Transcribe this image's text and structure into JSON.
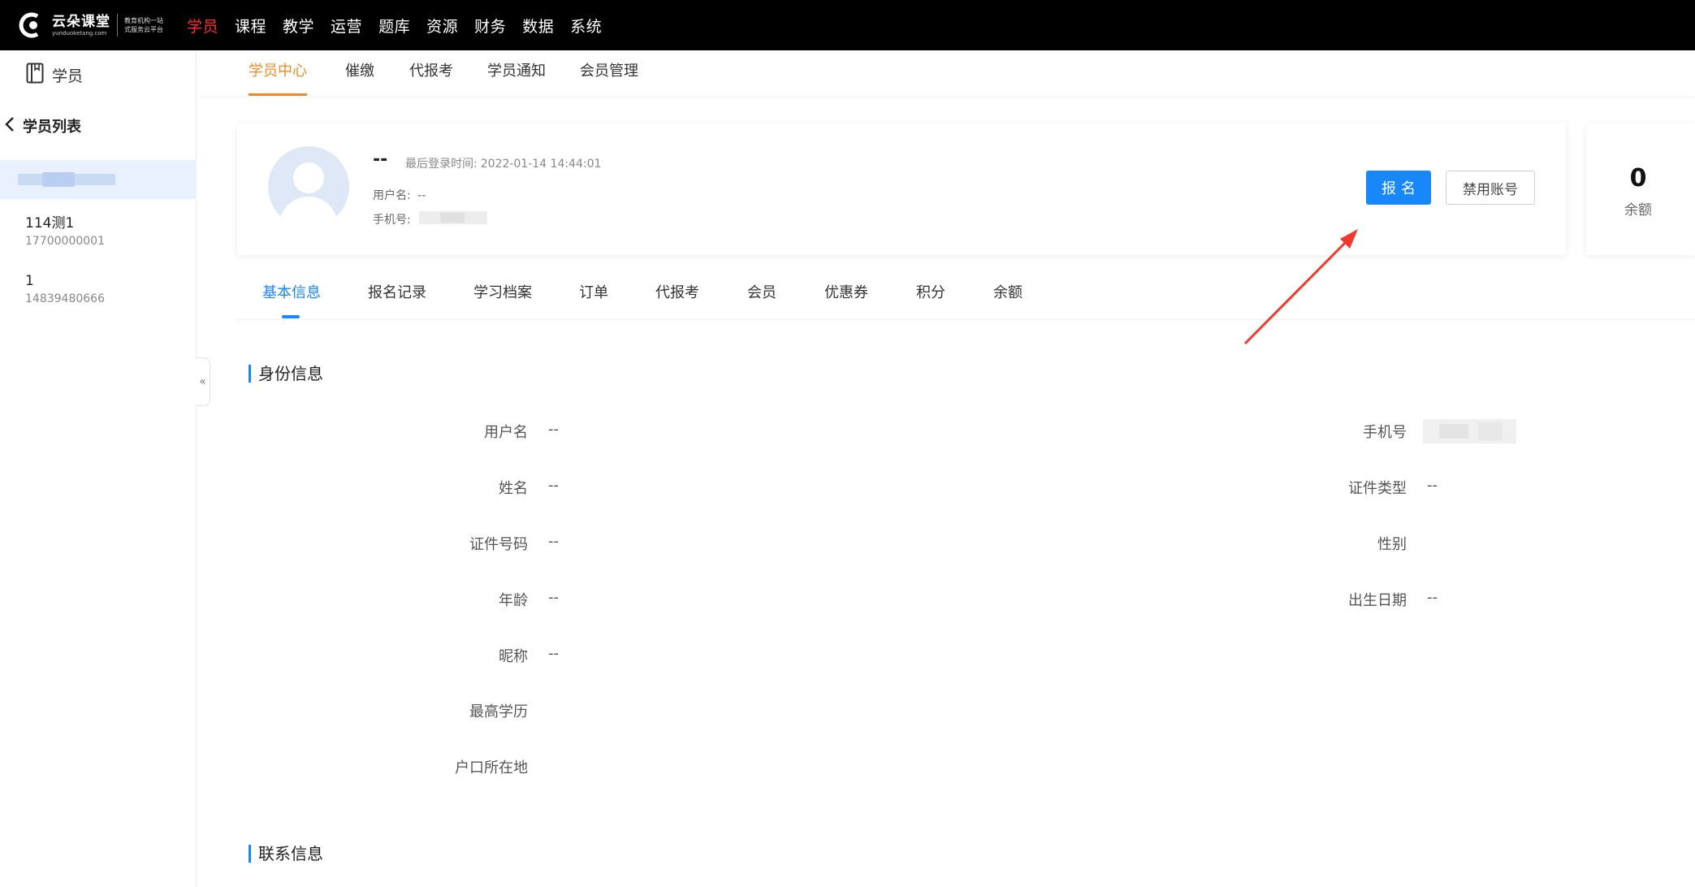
{
  "brand": {
    "name": "云朵课堂",
    "url": "yunduoketang.com",
    "slogan_line1": "教育机构一站",
    "slogan_line2": "式服务云平台"
  },
  "topnav": [
    "学员",
    "课程",
    "教学",
    "运营",
    "题库",
    "资源",
    "财务",
    "数据",
    "系统"
  ],
  "sidebar": {
    "title": "学员",
    "back_label": "学员列表",
    "students": [
      {
        "name": "114测1",
        "phone": "17700000001"
      },
      {
        "name": "1",
        "phone": "14839480666"
      }
    ],
    "collapse_glyph": "«"
  },
  "subnav": [
    "学员中心",
    "催缴",
    "代报考",
    "学员通知",
    "会员管理"
  ],
  "profile": {
    "name": "--",
    "last_login_label": "最后登录时间:",
    "last_login": "2022-01-14 14:44:01",
    "username_label": "用户名:",
    "username": "--",
    "phone_label": "手机号:",
    "enroll_button": "报名",
    "disable_button": "禁用账号"
  },
  "balance": {
    "value": "0",
    "label": "余额"
  },
  "tabs": [
    "基本信息",
    "报名记录",
    "学习档案",
    "订单",
    "代报考",
    "会员",
    "优惠券",
    "积分",
    "余额"
  ],
  "identity": {
    "title": "身份信息",
    "left": [
      {
        "label": "用户名",
        "value": "--"
      },
      {
        "label": "姓名",
        "value": "--"
      },
      {
        "label": "证件号码",
        "value": "--"
      },
      {
        "label": "年龄",
        "value": "--"
      },
      {
        "label": "昵称",
        "value": "--"
      },
      {
        "label": "最高学历",
        "value": ""
      },
      {
        "label": "户口所在地",
        "value": ""
      }
    ],
    "right": [
      {
        "label": "手机号",
        "value": ""
      },
      {
        "label": "证件类型",
        "value": "--"
      },
      {
        "label": "性别",
        "value": ""
      },
      {
        "label": "出生日期",
        "value": "--"
      }
    ]
  },
  "contact": {
    "title": "联系信息"
  },
  "colors": {
    "accent_blue": "#1787fb",
    "nav_active_red": "#ff2d2d",
    "subnav_active_orange": "#f08a24",
    "annotation_red": "#f03a2e"
  }
}
